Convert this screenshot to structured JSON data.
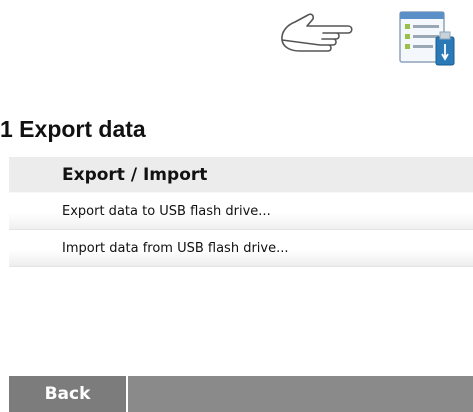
{
  "icons": {
    "pointer": "hand-pointing-right-icon",
    "device": "export-usb-icon"
  },
  "section": {
    "title": "1 Export data"
  },
  "menu": {
    "header": "Export / Import",
    "items": [
      {
        "label": "Export data to USB flash drive..."
      },
      {
        "label": "Import data from USB flash drive..."
      }
    ]
  },
  "footer": {
    "back_label": "Back"
  },
  "colors": {
    "header_bg": "#ececec",
    "footer_bg": "#8a8a8a",
    "back_bg": "#7c7c7c",
    "usb_accent": "#2a7ab8"
  }
}
